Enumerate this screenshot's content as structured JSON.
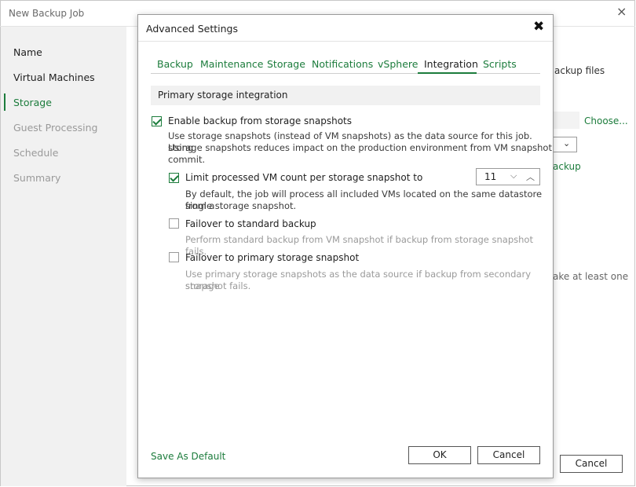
{
  "background": {
    "window_title": "New Backup Job",
    "close_icon": "×",
    "steps": [
      {
        "label": "Name",
        "state": "done"
      },
      {
        "label": "Virtual Machines",
        "state": "done"
      },
      {
        "label": "Storage",
        "state": "current"
      },
      {
        "label": "Guest Processing",
        "state": "disabled"
      },
      {
        "label": "Schedule",
        "state": "disabled"
      },
      {
        "label": "Summary",
        "state": "disabled"
      }
    ],
    "frag_backup_files": "ackup files",
    "choose_link": "Choose...",
    "backup_link_frag": "ackup",
    "frag_take_at_least": "ake at least one",
    "cancel_label": "Cancel"
  },
  "dialog": {
    "title": "Advanced Settings",
    "close_icon": "✖",
    "tabs": [
      "Backup",
      "Maintenance",
      "Storage",
      "Notifications",
      "vSphere",
      "Integration",
      "Scripts"
    ],
    "active_tab": "Integration",
    "section_header": "Primary storage integration",
    "enable_snapshots": {
      "label": "Enable backup from storage snapshots",
      "checked": true,
      "description": [
        "Use storage snapshots (instead of VM snapshots) as the data source for this job. Using",
        "storage snapshots reduces impact on the production environment from VM snapshot",
        "commit."
      ]
    },
    "limit_vm_count": {
      "label": "Limit processed VM count per storage snapshot to",
      "checked": true,
      "value": "11",
      "description": [
        "By default, the job will process all included VMs located on the same datastore from a",
        "single storage snapshot."
      ]
    },
    "failover_standard": {
      "label": "Failover to standard backup",
      "checked": false,
      "description": [
        "Perform standard backup from VM snapshot if backup from storage snapshot fails."
      ]
    },
    "failover_primary": {
      "label": "Failover to primary storage snapshot",
      "checked": false,
      "description": [
        "Use primary storage snapshots as the data source if backup from secondary storage",
        "snapshot fails."
      ]
    },
    "save_as_default": "Save As Default",
    "ok_label": "OK",
    "cancel_label": "Cancel"
  },
  "colors": {
    "accent": "#1c7c3c",
    "disabled_text": "#9a9a9a",
    "sidebar_bg": "#f1f1f1"
  }
}
